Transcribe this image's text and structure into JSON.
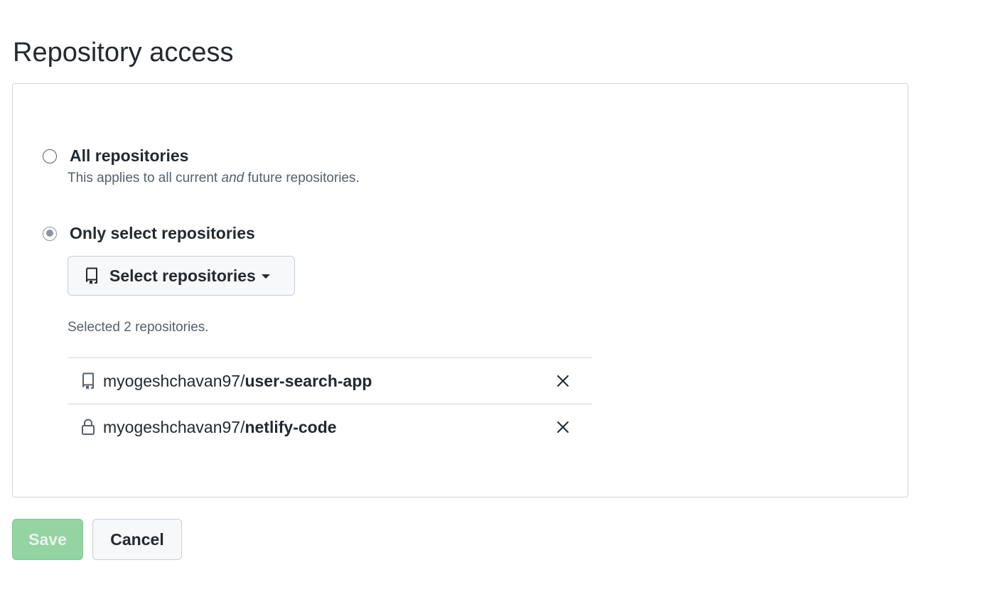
{
  "page": {
    "title": "Repository access"
  },
  "options": {
    "all": {
      "label": "All repositories",
      "note_prefix": "This applies to all current ",
      "note_emphasis": "and",
      "note_suffix": " future repositories.",
      "selected": false
    },
    "select": {
      "label": "Only select repositories",
      "selected": true
    }
  },
  "selector": {
    "label": "Select repositories",
    "icon": "repo-icon"
  },
  "selection": {
    "summary": "Selected 2 repositories."
  },
  "repositories": [
    {
      "owner": "myogeshchavan97/",
      "name": "user-search-app",
      "icon": "repo-icon",
      "remove_icon": "close-icon"
    },
    {
      "owner": "myogeshchavan97/",
      "name": "netlify-code",
      "icon": "lock-icon",
      "remove_icon": "close-icon"
    }
  ],
  "actions": {
    "save_label": "Save",
    "cancel_label": "Cancel",
    "save_disabled": true
  },
  "colors": {
    "save_bg": "#94d3a2",
    "text": "#24292f",
    "muted": "#57606a",
    "border": "#d0d7de"
  }
}
